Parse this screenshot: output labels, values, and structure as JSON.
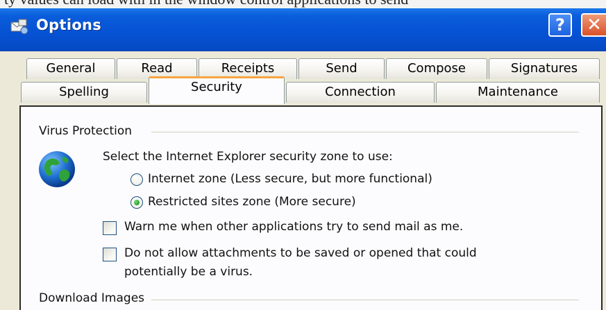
{
  "background_text": "ty values can load with in the window control applications to send",
  "window": {
    "title": "Options",
    "help_label": "?",
    "close_label": "✕",
    "icon": "mail-options-icon"
  },
  "tabs_row1": [
    "General",
    "Read",
    "Receipts",
    "Send",
    "Compose",
    "Signatures"
  ],
  "tabs_row2": [
    "Spelling",
    "Security",
    "Connection",
    "Maintenance"
  ],
  "active_tab": "Security",
  "virus_protection": {
    "group_label": "Virus Protection",
    "icon": "globe-icon",
    "zone_prompt": "Select the Internet Explorer security zone to use:",
    "zones": [
      {
        "label": "Internet zone (Less secure, but more functional)",
        "selected": false
      },
      {
        "label": "Restricted sites zone (More secure)",
        "selected": true
      }
    ],
    "warn_label": "Warn me when other applications try to send mail as me.",
    "warn_checked": false,
    "attach_label_line1": "Do not allow attachments to be saved or opened that could",
    "attach_label_line2": "potentially be a virus.",
    "attach_checked": false
  },
  "download_images": {
    "group_label": "Download Images"
  },
  "colors": {
    "titlebar": "#0653d5",
    "active_tab_accent": "#f7a440",
    "close_button": "#d9512a",
    "radio_selected": "#21a121"
  }
}
